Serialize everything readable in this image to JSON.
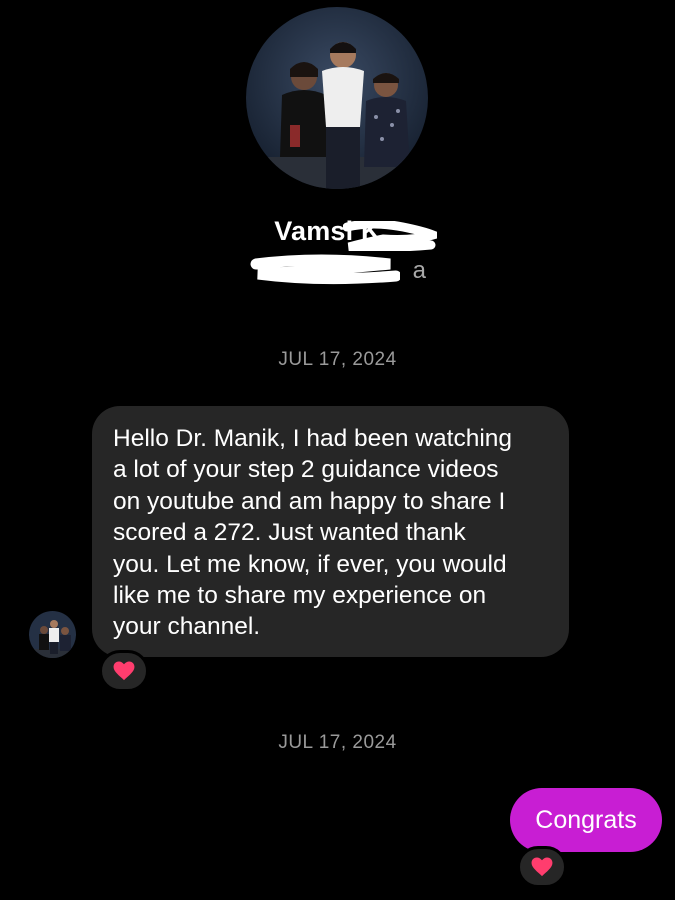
{
  "profile": {
    "name": "Vamsi K",
    "username_visible": "a",
    "avatar_icon": "group-photo-avatar"
  },
  "conversation": {
    "timestamps": [
      "JUL 17, 2024",
      "JUL 17, 2024"
    ],
    "incoming_message": {
      "text": "Hello Dr. Manik, I had been watching\na lot of your step 2 guidance videos\non youtube and am happy to share I\nscored a 272. Just wanted thank\nyou. Let me know, if ever, you would\nlike me to share my experience on\nyour channel.",
      "reaction_icon": "heart-icon"
    },
    "outgoing_message": {
      "text": "Congrats",
      "reaction_icon": "heart-icon"
    }
  },
  "colors": {
    "background": "#000000",
    "incoming_bubble": "#262626",
    "outgoing_bubble": "#c81ed3",
    "heart": "#ff3d6e",
    "timestamp": "#9a9a9a"
  }
}
